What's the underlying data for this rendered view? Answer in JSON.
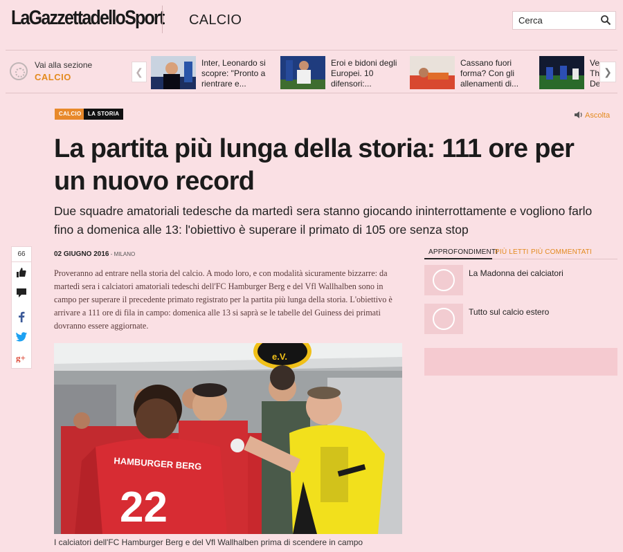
{
  "header": {
    "logo": "LaGazzettadelloSport",
    "section": "CALCIO",
    "search_placeholder": "Cerca"
  },
  "strip": {
    "vai_small": "Vai alla sezione",
    "vai_category": "CALCIO",
    "items": [
      {
        "text": "Inter, Leonardo si scopre: \"Pronto a rientrare e..."
      },
      {
        "text": "Eroi e bidoni degli Europei. 10 difensori:..."
      },
      {
        "text": "Cassano fuori forma? Con gli allenamenti di..."
      },
      {
        "text": "Ve Th De"
      }
    ]
  },
  "tags": {
    "calcio": "CALCIO",
    "storia": "LA STORIA"
  },
  "ascolta": "Ascolta",
  "article": {
    "headline": "La partita più lunga della storia: 111 ore per un nuovo record",
    "subhead": "Due squadre amatoriali tedesche da martedì sera stanno giocando ininterrottamente e vogliono farlo fino a domenica alle 13: l'obiettivo è superare il primato di 105 ore senza stop",
    "date": "02 GIUGNO 2016",
    "city": " - MILANO",
    "body": "Proveranno ad entrare nella storia del calcio. A modo loro, e con modalità sicuramente bizzarre: da martedì sera i calciatori amatoriali tedeschi dell'FC Hamburger Berg e del Vfl Wallhalben sono in campo per superare il precedente primato registrato per la partita più lunga della storia. L'obiettivo è arrivare a 111 ore di fila in campo: domenica alle 13 si saprà se le tabelle del Guiness dei primati dovranno essere aggiornate.",
    "caption": "I calciatori dell'FC Hamburger Berg e del Vfl Wallhalben prima di scendere in campo",
    "photo": {
      "jersey_text": "HAMBURGER BERG",
      "jersey_number": "22",
      "sponsor_text": "e.V."
    }
  },
  "share": {
    "count": "66"
  },
  "sidebar": {
    "tabs": [
      "APPROFONDIMENTI",
      "PIÙ LETTI",
      "PIÙ COMMENTATI"
    ],
    "items": [
      "La Madonna dei calciatori",
      "Tutto sul calcio estero"
    ]
  },
  "colors": {
    "accent": "#e38a1e",
    "background": "#fae0e4"
  }
}
